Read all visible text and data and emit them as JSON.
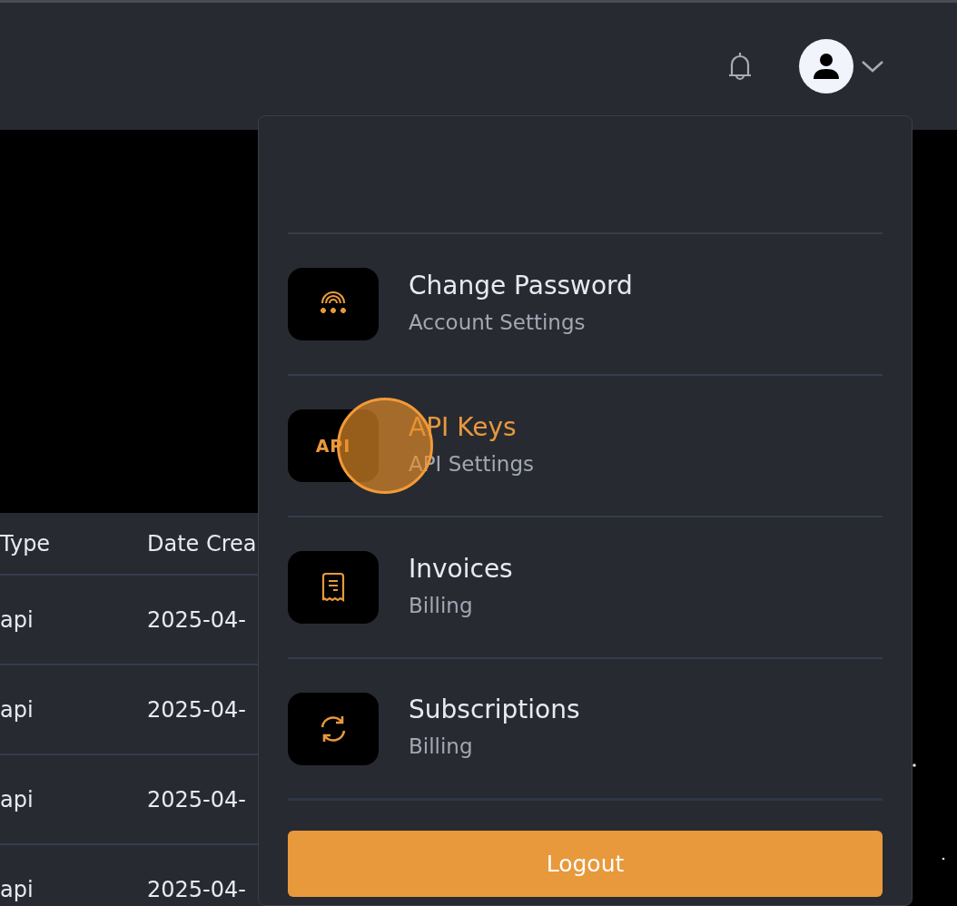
{
  "header": {
    "profile_menu": {
      "expanded": true
    }
  },
  "table": {
    "columns": [
      "Type",
      "Date Crea"
    ],
    "rows": [
      [
        "api",
        "2025-04-"
      ],
      [
        "api",
        "2025-04-"
      ],
      [
        "api",
        "2025-04-"
      ],
      [
        "api",
        "2025-04-"
      ]
    ]
  },
  "dropdown": {
    "items": [
      {
        "kind": "password",
        "title": "Change Password",
        "subtitle": "Account Settings",
        "selected": false
      },
      {
        "kind": "api",
        "icon_text": "API",
        "title": "API Keys",
        "subtitle": "API Settings",
        "selected": true
      },
      {
        "kind": "invoice",
        "title": "Invoices",
        "subtitle": "Billing",
        "selected": false
      },
      {
        "kind": "sync",
        "title": "Subscriptions",
        "subtitle": "Billing",
        "selected": false
      }
    ],
    "logout": "Logout"
  }
}
